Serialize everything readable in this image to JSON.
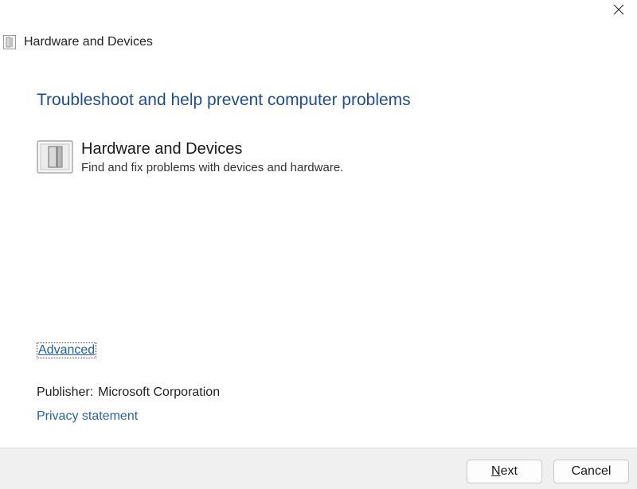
{
  "window": {
    "title": "Hardware and Devices",
    "close_glyph": "×"
  },
  "content": {
    "heading": "Troubleshoot and help prevent computer problems",
    "troubleshooter": {
      "title": "Hardware and Devices",
      "description": "Find and fix problems with devices and hardware.",
      "icon": "device-icon"
    },
    "advanced_link": "Advanced",
    "publisher_label": "Publisher:",
    "publisher_value": "Microsoft Corporation",
    "privacy_link": "Privacy statement"
  },
  "footer": {
    "next_mnemonic": "N",
    "next_rest": "ext",
    "cancel_label": "Cancel"
  },
  "colors": {
    "heading": "#1f4e8c",
    "link": "#1f5fa8",
    "footer_bg": "#f0f0f0"
  }
}
